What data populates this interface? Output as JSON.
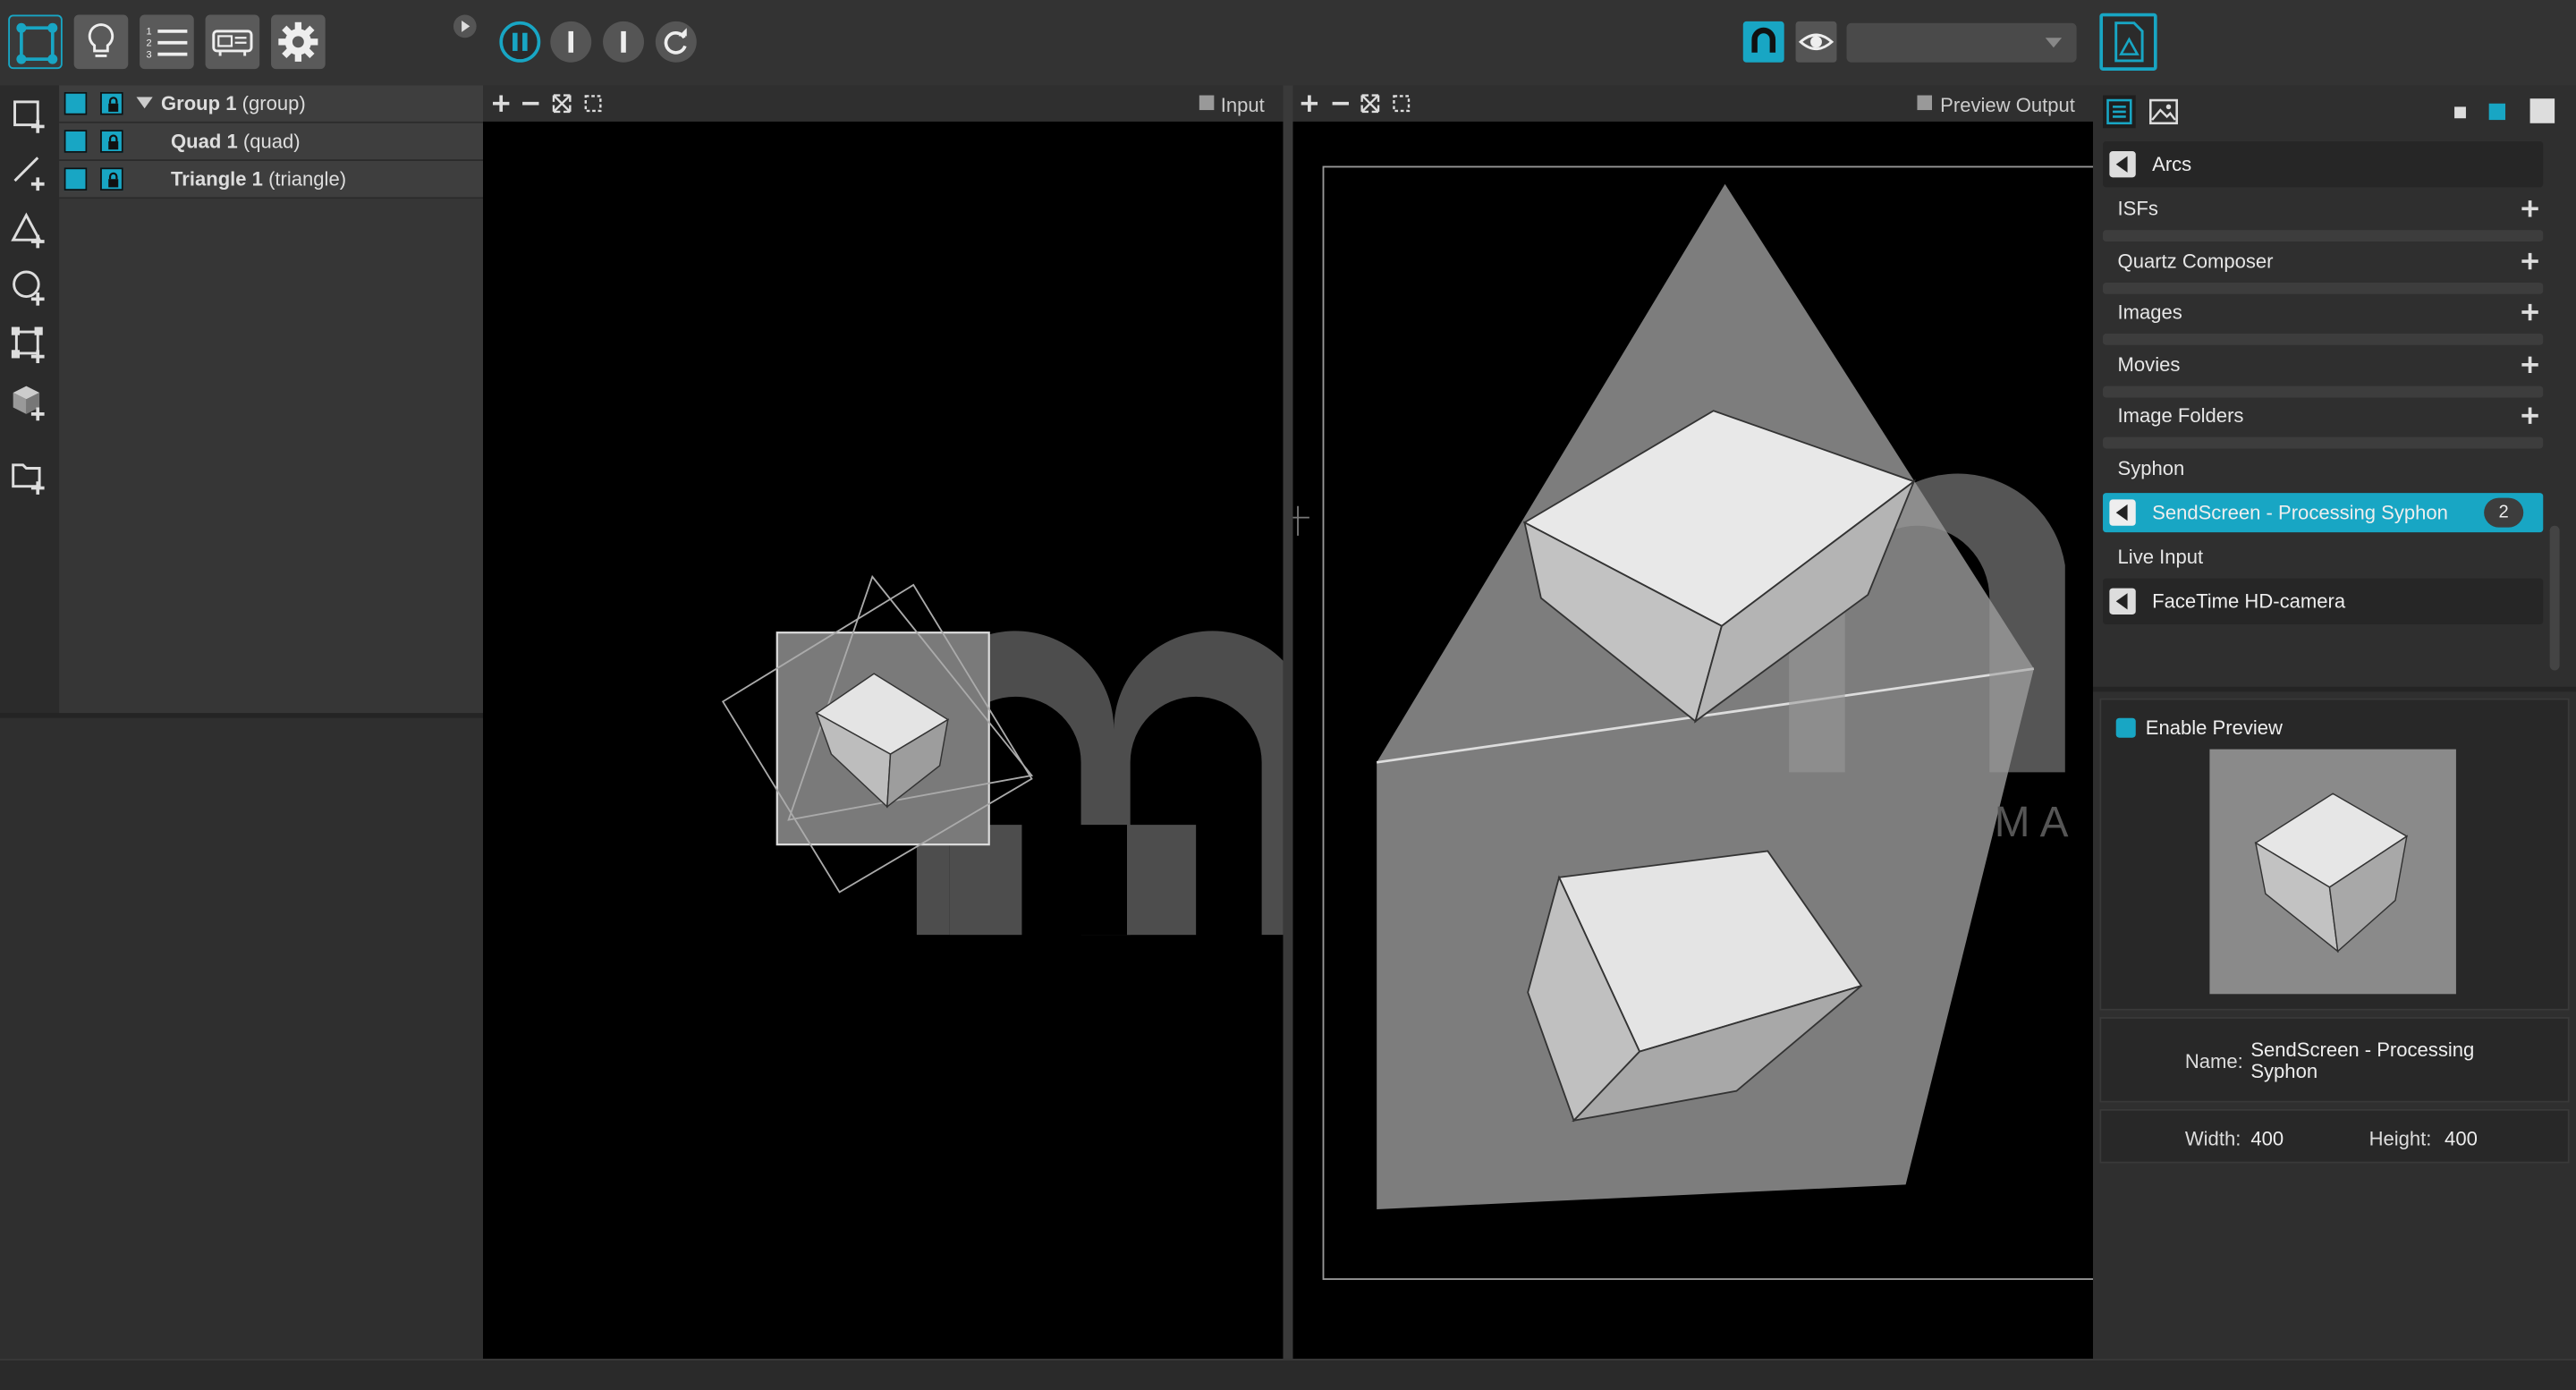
{
  "colors": {
    "accent": "#18a6c4",
    "background": "#2b2b2b",
    "canvas": "#000000"
  },
  "toolbar": {
    "left_buttons": [
      "surface-mode-icon",
      "lightbulb-icon",
      "numbered-list-icon",
      "projector-icon",
      "gear-icon"
    ],
    "transport": [
      "pause-icon",
      "stop-icon",
      "stop-icon",
      "redo-icon"
    ],
    "right": [
      "magnet-icon",
      "eye-icon",
      "output-dropdown",
      "media-document-icon"
    ],
    "dropdown_value": ""
  },
  "layers": [
    {
      "name": "Group 1",
      "type": "(group)",
      "expanded": true
    },
    {
      "name": "Quad 1",
      "type": "(quad)"
    },
    {
      "name": "Triangle 1",
      "type": "(triangle)"
    }
  ],
  "input_canvas": {
    "label": "Input",
    "checked": false
  },
  "output_canvas": {
    "label": "Preview Output",
    "checked": false
  },
  "sources": {
    "top_item": "Arcs",
    "categories": [
      "ISFs",
      "Quartz Composer",
      "Images",
      "Movies",
      "Image Folders"
    ],
    "syphon": {
      "label": "Syphon",
      "item": "SendScreen - Processing Syphon",
      "count": "2"
    },
    "live_input": {
      "label": "Live Input",
      "item": "FaceTime HD-camera"
    }
  },
  "preview": {
    "enable_label": "Enable Preview",
    "enabled": true
  },
  "properties": {
    "name_label": "Name:",
    "name_value": "SendScreen - Processing Syphon",
    "width_label": "Width:",
    "width_value": "400",
    "height_label": "Height:",
    "height_value": "400"
  },
  "watermark": {
    "letters": "MA"
  }
}
